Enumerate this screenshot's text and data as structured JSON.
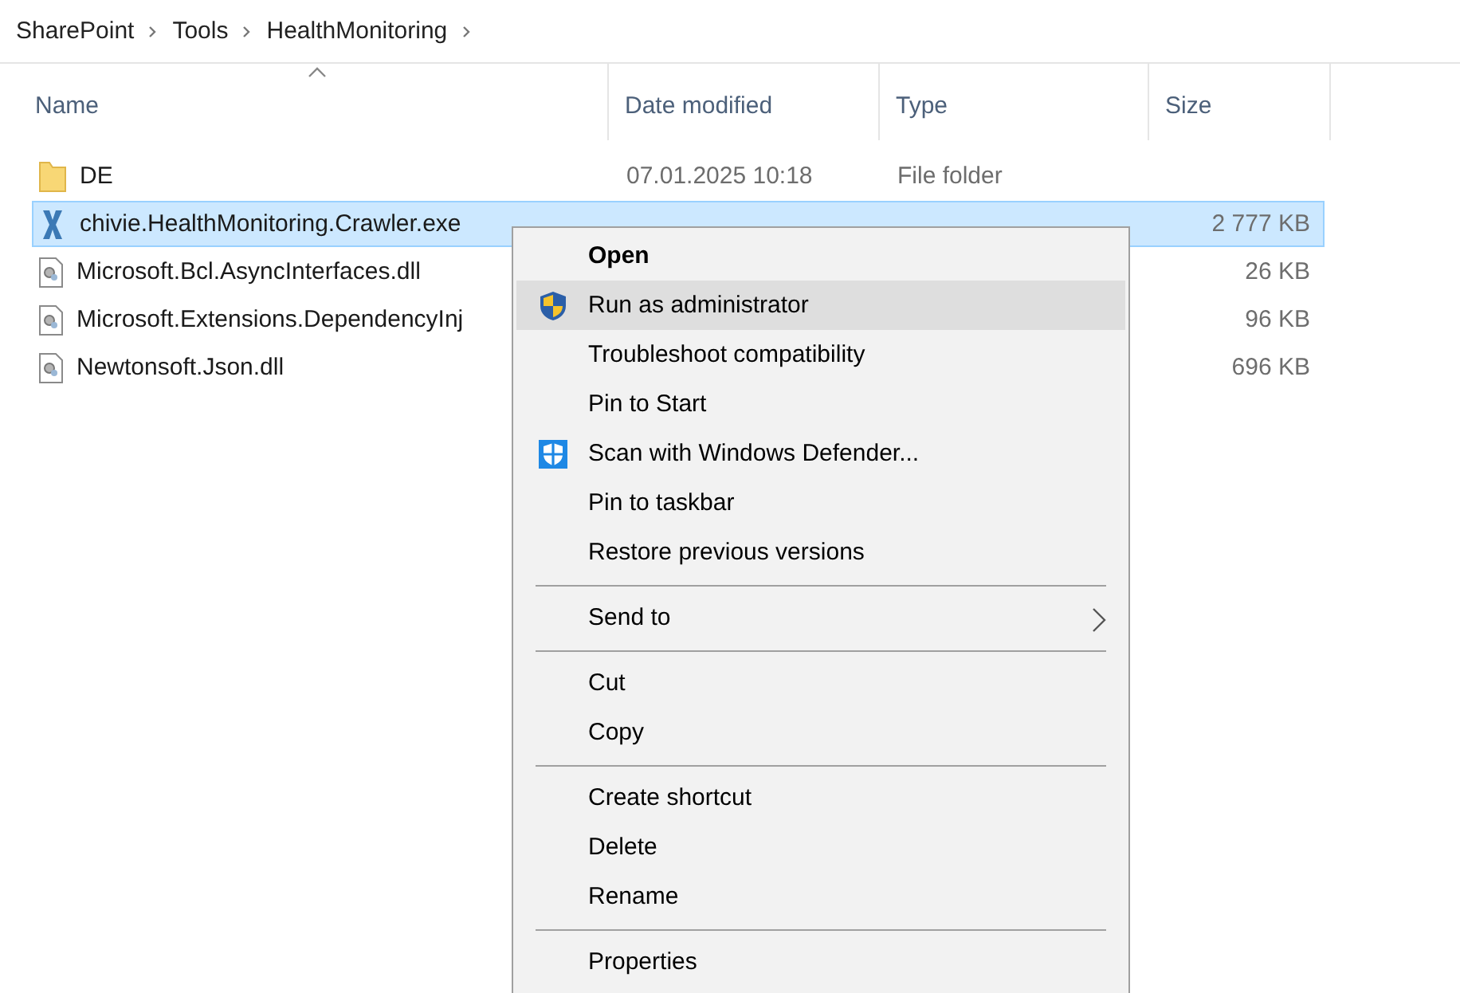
{
  "breadcrumb": [
    "SharePoint",
    "Tools",
    "HealthMonitoring"
  ],
  "columns": [
    {
      "label": "Name",
      "sorted": true
    },
    {
      "label": "Date modified",
      "sorted": false
    },
    {
      "label": "Type",
      "sorted": false
    },
    {
      "label": "Size",
      "sorted": false
    }
  ],
  "files": [
    {
      "kind": "folder",
      "name": "DE",
      "date": "07.01.2025 10:18",
      "type": "File folder",
      "selected": false
    },
    {
      "kind": "exe",
      "name": "chivie.HealthMonitoring.Crawler.exe",
      "size": "2 777 KB",
      "selected": true
    },
    {
      "kind": "dll",
      "name": "Microsoft.Bcl.AsyncInterfaces.dll",
      "size": "26 KB",
      "selected": false
    },
    {
      "kind": "dll",
      "name": "Microsoft.Extensions.DependencyInj",
      "size": "96 KB",
      "selected": false
    },
    {
      "kind": "dll",
      "name": "Newtonsoft.Json.dll",
      "size": "696 KB",
      "selected": false
    }
  ],
  "context_menu": [
    {
      "kind": "default",
      "label": "Open",
      "selected": false
    },
    {
      "kind": "shield",
      "label": "Run as administrator",
      "selected": true
    },
    {
      "kind": "item",
      "label": "Troubleshoot compatibility",
      "selected": false
    },
    {
      "kind": "item",
      "label": "Pin to Start",
      "selected": false
    },
    {
      "kind": "defender",
      "label": "Scan with Windows Defender...",
      "selected": false
    },
    {
      "kind": "item",
      "label": "Pin to taskbar",
      "selected": false
    },
    {
      "kind": "item",
      "label": "Restore previous versions",
      "selected": false
    },
    {
      "kind": "separator"
    },
    {
      "kind": "submenu",
      "label": "Send to",
      "selected": false
    },
    {
      "kind": "separator"
    },
    {
      "kind": "item",
      "label": "Cut",
      "selected": false
    },
    {
      "kind": "item",
      "label": "Copy",
      "selected": false
    },
    {
      "kind": "separator"
    },
    {
      "kind": "item",
      "label": "Create shortcut",
      "selected": false
    },
    {
      "kind": "item",
      "label": "Delete",
      "selected": false
    },
    {
      "kind": "item",
      "label": "Rename",
      "selected": false
    },
    {
      "kind": "separator"
    },
    {
      "kind": "item",
      "label": "Properties",
      "selected": false
    }
  ]
}
